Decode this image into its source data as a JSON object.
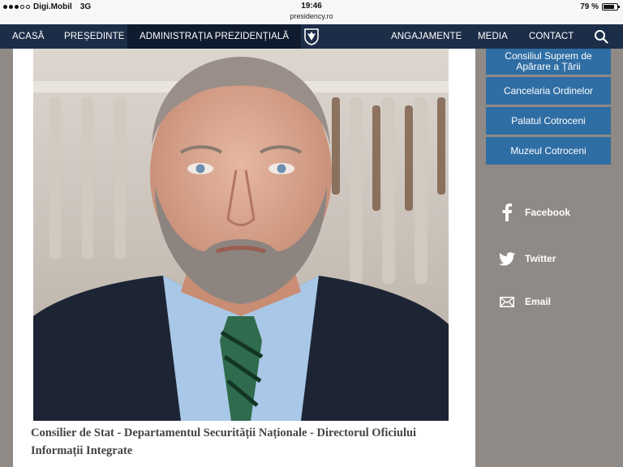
{
  "status_bar": {
    "carrier": "Digi.Mobil",
    "network": "3G",
    "time": "19:46",
    "url": "presidency.ro",
    "battery": "79 %",
    "battery_level": 0.79
  },
  "nav": {
    "items": [
      "ACASĂ",
      "PREȘEDINTE",
      "ADMINISTRAȚIA PREZIDENȚIALĂ",
      "ANGAJAMENTE",
      "MEDIA",
      "CONTACT"
    ],
    "active_index": 2,
    "background": "#1c2d48"
  },
  "main": {
    "caption": "Consilier de Stat - Departamentul Securității Naționale - Directorul Oficiului Informații Integrate"
  },
  "sidebar": {
    "links": [
      "Consiliul Suprem de Apărare a Țării",
      "Cancelaria Ordinelor",
      "Palatul Cotroceni",
      "Muzeul Cotroceni"
    ],
    "accent": "#2f6ea4"
  },
  "social": [
    "Facebook",
    "Twitter",
    "Email"
  ]
}
